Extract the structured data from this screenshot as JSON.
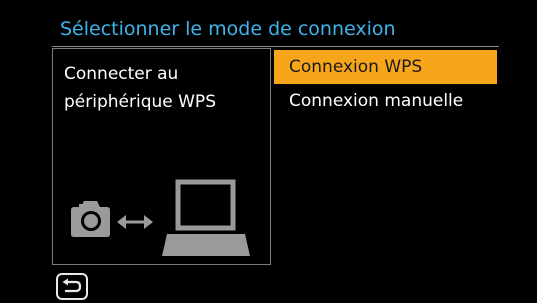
{
  "header": {
    "title": "Sélectionner le mode de connexion"
  },
  "info_panel": {
    "description_line1": "Connecter au",
    "description_line2": "périphérique WPS",
    "icons": [
      "camera-icon",
      "bidirectional-arrow-icon",
      "laptop-icon"
    ]
  },
  "menu": {
    "items": [
      {
        "label": "Connexion WPS",
        "selected": true
      },
      {
        "label": "Connexion manuelle",
        "selected": false
      }
    ]
  },
  "footer": {
    "back_icon": "return-arrow-icon"
  },
  "colors": {
    "title": "#3fb4ec",
    "selection": "#f7a61c",
    "background": "#000000",
    "icon_gray": "#9a9a9a"
  }
}
